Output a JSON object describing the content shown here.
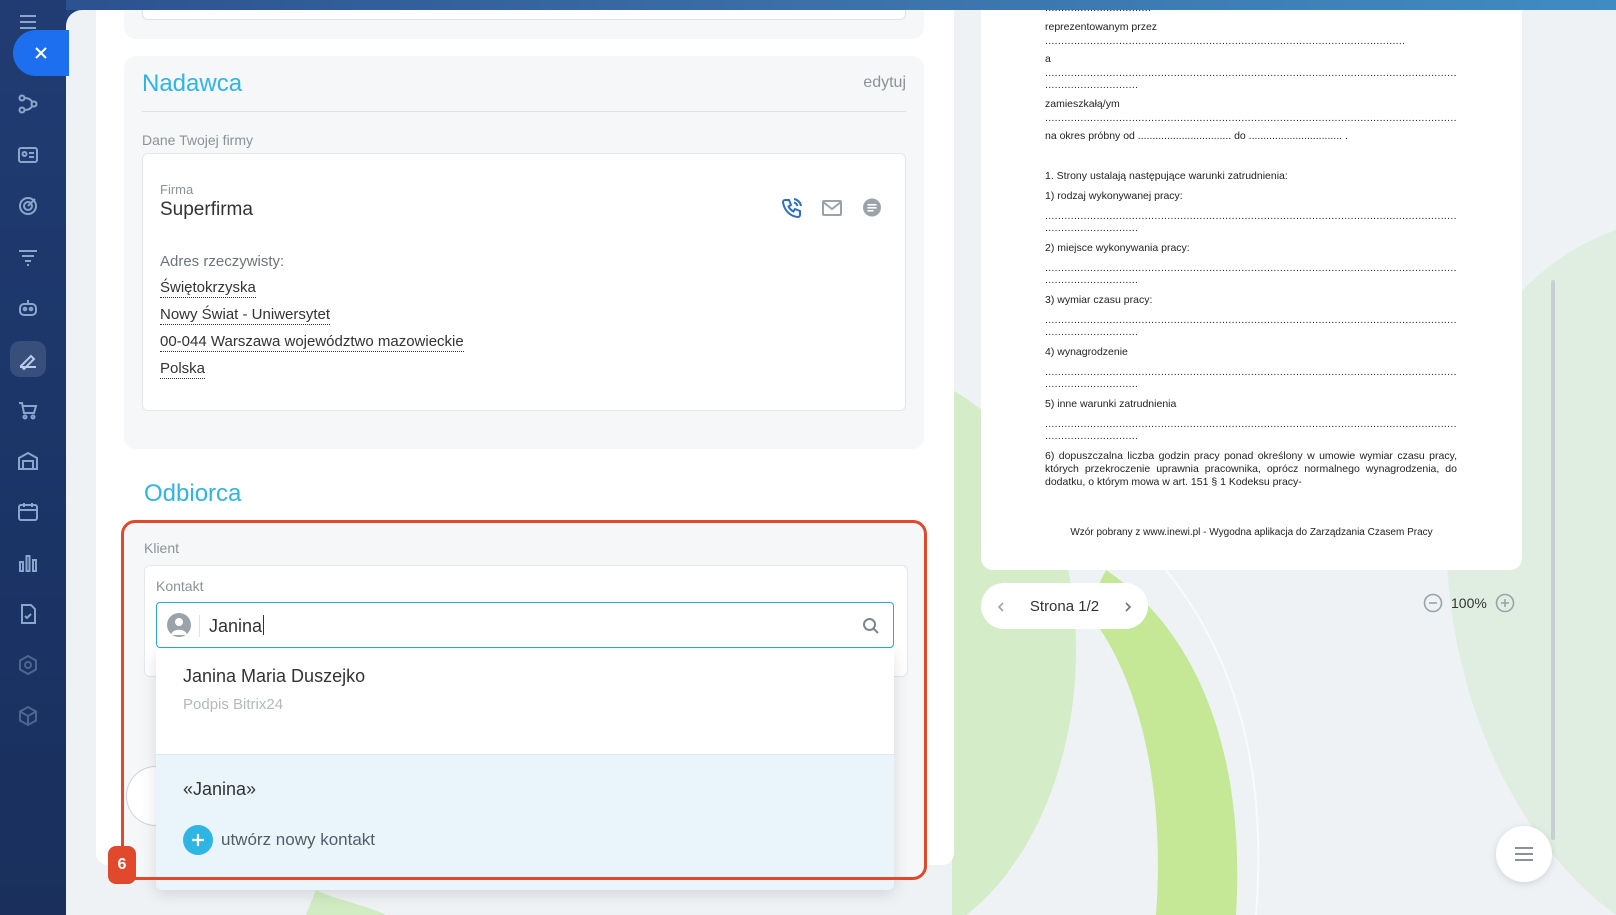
{
  "sender": {
    "title": "Nadawca",
    "edit_label": "edytuj",
    "company_section_label": "Dane Twojej firmy",
    "firm_label": "Firma",
    "firm_name": "Superfirma",
    "address_label": "Adres rzeczywisty:",
    "address_lines": [
      "Świętokrzyska",
      "Nowy Świat - Uniwersytet",
      "00-044 Warszawa województwo mazowieckie",
      "Polska"
    ]
  },
  "recipient": {
    "title": "Odbiorca",
    "client_label": "Klient",
    "contact_label": "Kontakt",
    "search_value": "Janina",
    "results": [
      {
        "name": "Janina Maria Duszejko",
        "source": "Podpis Bitrix24"
      }
    ],
    "query_label": "«Janina»",
    "create_label": "utwórz nowy kontakt"
  },
  "step_badge": "6",
  "document": {
    "lines": {
      "represented": "reprezentowanym przez",
      "a": "a",
      "resident": "zamieszkałą/ym",
      "trial": "na okres próbny od ................................ do ................................ .",
      "p1": "1. Strony ustalają następujące warunki zatrudnienia:",
      "i1": "1) rodzaj wykonywanej pracy:",
      "i2": "2) miejsce wykonywania pracy:",
      "i3": "3) wymiar czasu pracy:",
      "i4": "4) wynagrodzenie",
      "i5": "5) inne warunki zatrudnienia",
      "i6": "6) dopuszczalna liczba godzin pracy ponad określony w umowie wymiar czasu pracy, których przekroczenie uprawnia pracownika, oprócz normalnego wynagrodzenia, do dodatku, o którym mowa w art. 151 § 1 Kodeksu pracy-"
    },
    "footer": "Wzór pobrany z www.inewi.pl - Wygodna aplikacja do Zarządzania Czasem Pracy"
  },
  "pager": {
    "label": "Strona 1/2"
  },
  "zoom": {
    "label": "100%"
  },
  "colors": {
    "accent": "#2fb5e4",
    "highlight": "#e0492b",
    "close": "#1e6ff0"
  },
  "icons": {
    "sidebar": [
      "menu-icon",
      "flow-icon",
      "contact-card-icon",
      "target-icon",
      "funnel-icon",
      "robot-icon",
      "sign-icon",
      "cart-icon",
      "warehouse-icon",
      "calendar-icon",
      "chart-icon",
      "document-check-icon",
      "hexagon-icon",
      "cube-icon"
    ]
  }
}
